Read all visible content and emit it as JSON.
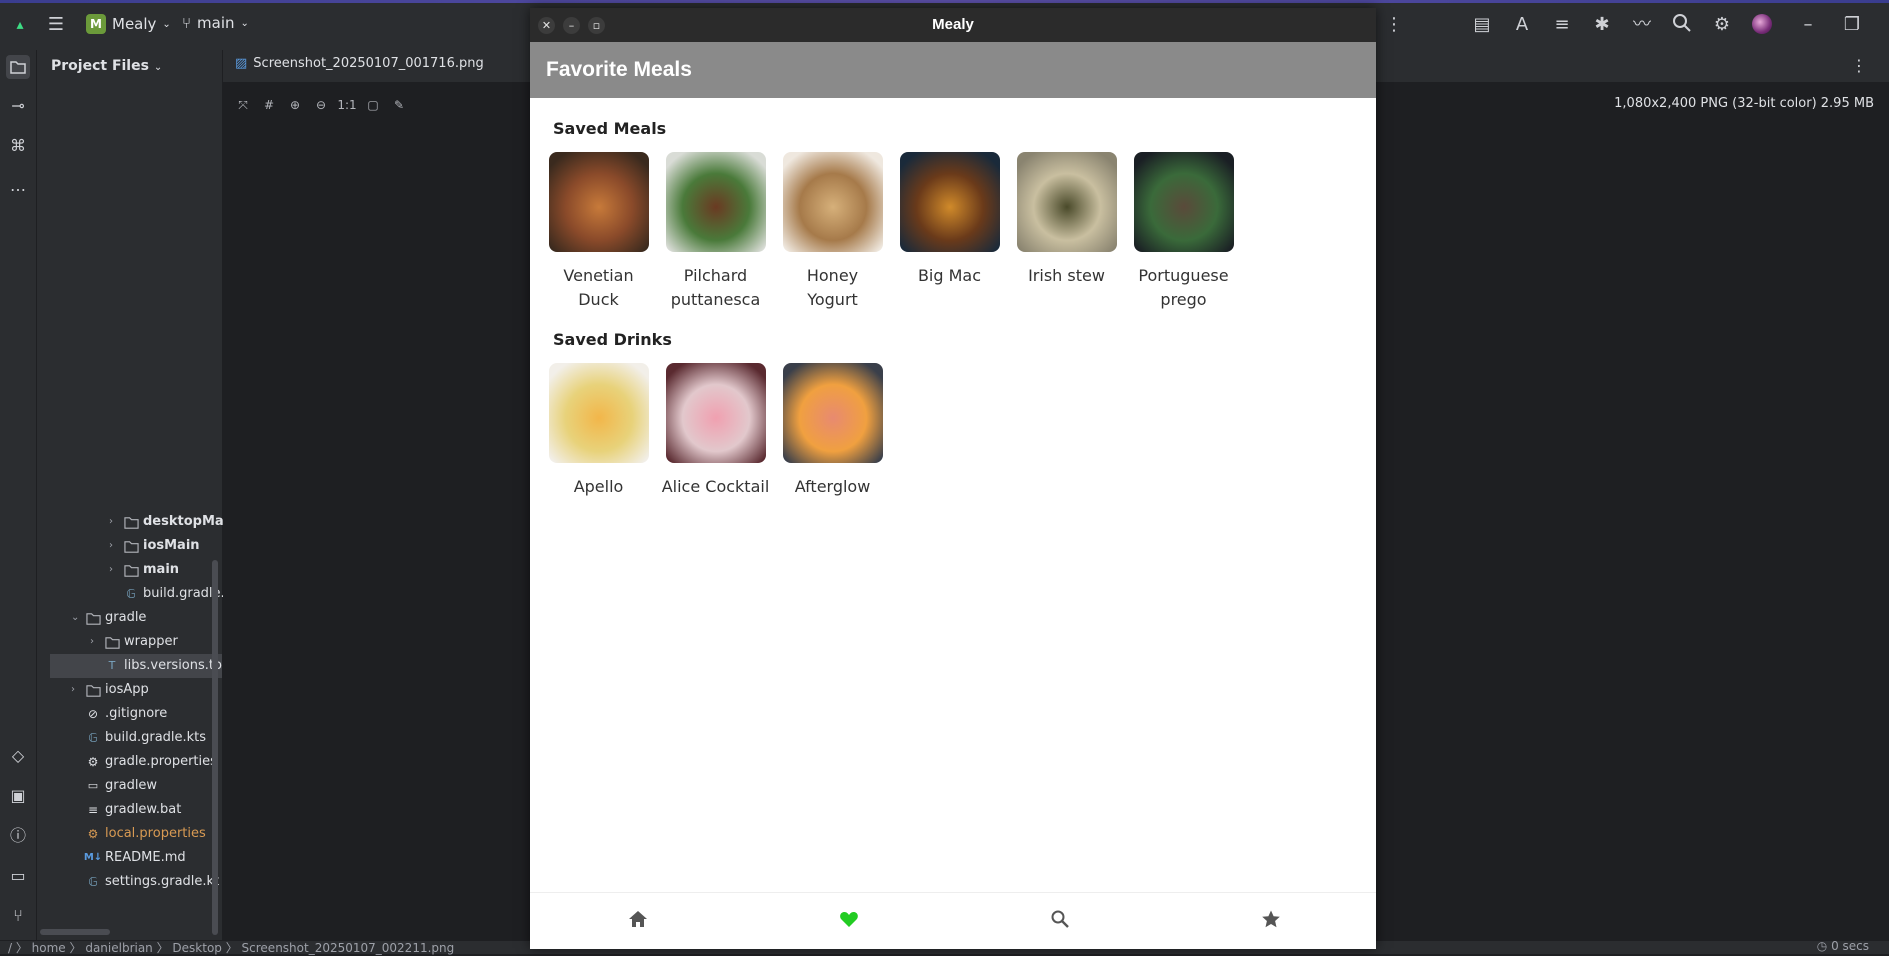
{
  "ide": {
    "project_name": "Mealy",
    "branch": "main",
    "panel_title": "Project Files",
    "editor_tab": "Screenshot_20250107_001716.png",
    "image_info": "1,080x2,400 PNG (32-bit color) 2.95 MB",
    "zoom_label": "1:1",
    "tree": [
      {
        "label": "desktopMai",
        "type": "folder"
      },
      {
        "label": "iosMain",
        "type": "folder"
      },
      {
        "label": "main",
        "type": "folder"
      },
      {
        "label": "build.gradle.kts",
        "type": "gradle"
      },
      {
        "label": "gradle",
        "type": "folder"
      },
      {
        "label": "wrapper",
        "type": "folder"
      },
      {
        "label": "libs.versions.to",
        "type": "toml"
      },
      {
        "label": "iosApp",
        "type": "folder"
      },
      {
        "label": ".gitignore",
        "type": "ignore"
      },
      {
        "label": "build.gradle.kts",
        "type": "gradle"
      },
      {
        "label": "gradle.properties",
        "type": "settings"
      },
      {
        "label": "gradlew",
        "type": "script"
      },
      {
        "label": "gradlew.bat",
        "type": "text"
      },
      {
        "label": "local.properties",
        "type": "settings"
      },
      {
        "label": "README.md",
        "type": "markdown"
      },
      {
        "label": "settings.gradle.kt",
        "type": "gradle"
      }
    ],
    "status_path": "/ 〉 home 〉 danielbrian 〉 Desktop 〉 Screenshot_20250107_002211.png",
    "status_right": "0 secs"
  },
  "app": {
    "window_title": "Mealy",
    "header_title": "Favorite Meals",
    "meals_title": "Saved Meals",
    "drinks_title": "Saved Drinks",
    "meals": [
      {
        "name": "Venetian Duck",
        "colors": [
          "#3a2a1e",
          "#c77a3a",
          "#8a4a2a"
        ]
      },
      {
        "name": "Pilchard puttanesca",
        "colors": [
          "#d9dcd6",
          "#6a3a22",
          "#4a7a3a"
        ]
      },
      {
        "name": "Honey Yogurt",
        "colors": [
          "#efe8df",
          "#d6b07a",
          "#a67a4a"
        ]
      },
      {
        "name": "Big Mac",
        "colors": [
          "#1a2a3a",
          "#d08a2a",
          "#6a3a1a"
        ]
      },
      {
        "name": "Irish stew",
        "colors": [
          "#8a8470",
          "#4a4a2a",
          "#c9bfa0"
        ]
      },
      {
        "name": "Portuguese prego",
        "colors": [
          "#1a1f24",
          "#5a4a3a",
          "#3a6a3a"
        ]
      }
    ],
    "drinks": [
      {
        "name": "Apello",
        "colors": [
          "#f2efe9",
          "#f2b64a",
          "#e8d27a"
        ]
      },
      {
        "name": "Alice Cocktail",
        "colors": [
          "#5a2a30",
          "#f0a0b0",
          "#e2c8cc"
        ]
      },
      {
        "name": "Afterglow",
        "colors": [
          "#3a3f4a",
          "#e88a70",
          "#f0a040"
        ]
      }
    ],
    "nav": [
      {
        "icon": "home-icon",
        "color": "#555555"
      },
      {
        "icon": "heart-icon",
        "color": "#22cc22"
      },
      {
        "icon": "search-icon",
        "color": "#555555"
      },
      {
        "icon": "star-icon",
        "color": "#555555"
      }
    ]
  }
}
